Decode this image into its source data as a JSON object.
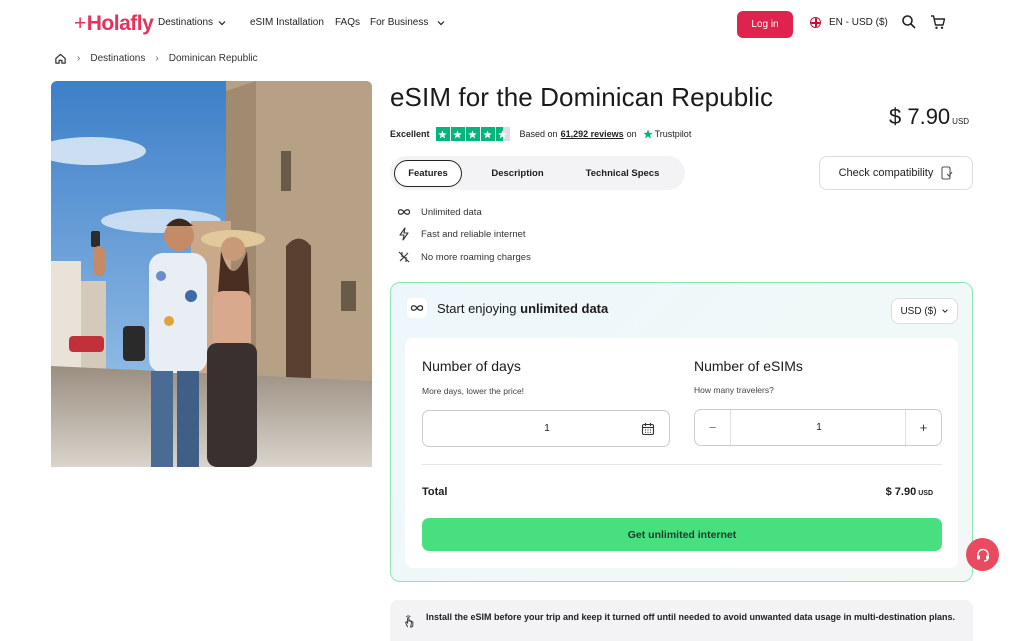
{
  "header": {
    "logo": "Holafly",
    "nav": [
      {
        "label": "Destinations",
        "has_dropdown": true
      },
      {
        "label": "eSIM Installation",
        "has_dropdown": false
      },
      {
        "label": "FAQs",
        "has_dropdown": false
      },
      {
        "label": "For Business",
        "has_dropdown": true
      }
    ],
    "login_label": "Log in",
    "language_currency": "EN - USD ($)",
    "icons": [
      "search-icon",
      "cart-icon"
    ]
  },
  "breadcrumb": {
    "items": [
      "Destinations",
      "Dominican Republic"
    ]
  },
  "product": {
    "title": "eSIM for the Dominican Republic",
    "price": "$ 7.90",
    "price_currency": "USD",
    "rating": {
      "label": "Excellent",
      "stars": 4.5,
      "based_on": "Based on",
      "reviews": "61,292 reviews",
      "on": "on",
      "provider": "Trustpilot"
    }
  },
  "tabs": [
    "Features",
    "Description",
    "Technical Specs"
  ],
  "check_compat_label": "Check compatibility",
  "features": [
    {
      "icon": "infinity-icon",
      "label": "Unlimited data"
    },
    {
      "icon": "lightning-icon",
      "label": "Fast and reliable internet"
    },
    {
      "icon": "no-roaming-icon",
      "label": "No more roaming charges"
    }
  ],
  "plan": {
    "heading_prefix": "Start enjoying",
    "heading_bold": "unlimited data",
    "currency_select": "USD ($)",
    "days": {
      "label": "Number of days",
      "hint": "More days, lower the price!",
      "value": "1"
    },
    "esims": {
      "label": "Number of eSIMs",
      "hint": "How many travelers?",
      "value": "1",
      "minus": "−",
      "plus": "+"
    },
    "total_label": "Total",
    "total_value": "$ 7.90",
    "total_currency": "USD",
    "cta_label": "Get unlimited internet"
  },
  "notice": "Install the eSIM before your trip and keep it turned off until needed to avoid unwanted data usage in multi-destination plans.",
  "colors": {
    "brand": "#e5325a",
    "login": "#e0234e",
    "cta": "#48e07e",
    "trustpilot": "#00b67a",
    "plan_border": "#8ee6b4"
  }
}
